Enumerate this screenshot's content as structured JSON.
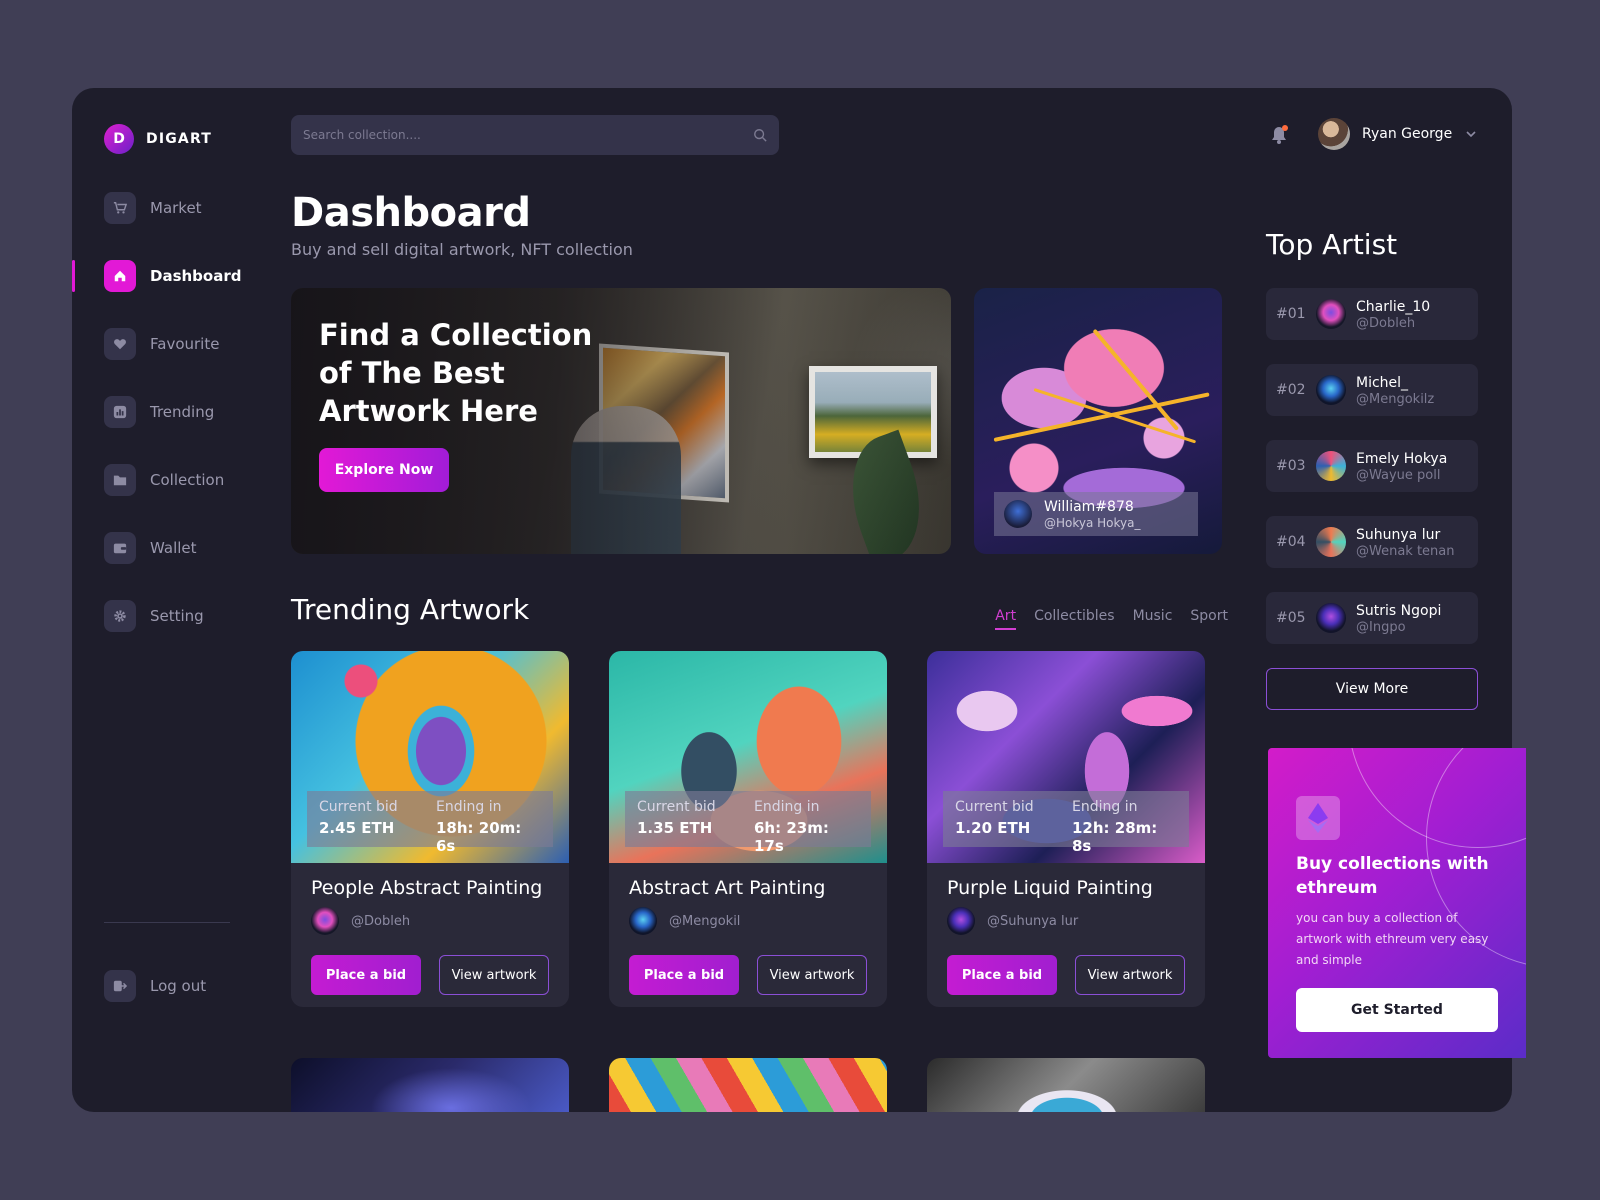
{
  "brand": {
    "logo_letter": "D",
    "name": "DIGART"
  },
  "sidebar": {
    "items": [
      {
        "label": "Market",
        "icon": "cart-icon"
      },
      {
        "label": "Dashboard",
        "icon": "home-icon",
        "active": true
      },
      {
        "label": "Favourite",
        "icon": "heart-icon"
      },
      {
        "label": "Trending",
        "icon": "chart-icon"
      },
      {
        "label": "Collection",
        "icon": "folder-icon"
      },
      {
        "label": "Wallet",
        "icon": "wallet-icon"
      },
      {
        "label": "Setting",
        "icon": "gear-icon"
      }
    ],
    "logout_label": "Log out"
  },
  "header": {
    "search_placeholder": "Search collection....",
    "user_name": "Ryan George"
  },
  "page": {
    "title": "Dashboard",
    "subtitle": "Buy and sell digital artwork, NFT collection"
  },
  "hero": {
    "title": "Find a Collection of The Best Artwork Here",
    "cta": "Explore Now"
  },
  "featured": {
    "name": "William#878",
    "handle": "@Hokya Hokya_"
  },
  "trending": {
    "title": "Trending Artwork",
    "tabs": [
      "Art",
      "Collectibles",
      "Music",
      "Sport"
    ],
    "active_tab": "Art",
    "bid_label": "Current bid",
    "ending_label": "Ending in",
    "place_bid_label": "Place a bid",
    "view_label": "View artwork",
    "cards": [
      {
        "title": "People Abstract Painting",
        "owner": "@Dobleh",
        "bid": "2.45 ETH",
        "ending": "18h: 20m: 6s"
      },
      {
        "title": "Abstract Art Painting",
        "owner": "@Mengokil",
        "bid": "1.35 ETH",
        "ending": "6h: 23m: 17s"
      },
      {
        "title": "Purple Liquid Painting",
        "owner": "@Suhunya lur",
        "bid": "1.20 ETH",
        "ending": "12h: 28m: 8s"
      }
    ]
  },
  "top_artist": {
    "title": "Top Artist",
    "items": [
      {
        "rank": "#01",
        "name": "Charlie_10",
        "handle": "@Dobleh"
      },
      {
        "rank": "#02",
        "name": "Michel_",
        "handle": "@Mengokilz"
      },
      {
        "rank": "#03",
        "name": "Emely Hokya",
        "handle": "@Wayue poll"
      },
      {
        "rank": "#04",
        "name": "Suhunya lur",
        "handle": "@Wenak tenan"
      },
      {
        "rank": "#05",
        "name": "Sutris Ngopi",
        "handle": "@Ingpo"
      }
    ],
    "view_more": "View More"
  },
  "promo": {
    "title": "Buy collections with ethreum",
    "text": "you can buy a collection of artwork with ethreum very easy and simple",
    "cta": "Get Started",
    "icon": "ethereum-icon"
  },
  "colors": {
    "accent": "#e219d6",
    "background": "#1e1d2b",
    "page": "#403e55"
  }
}
